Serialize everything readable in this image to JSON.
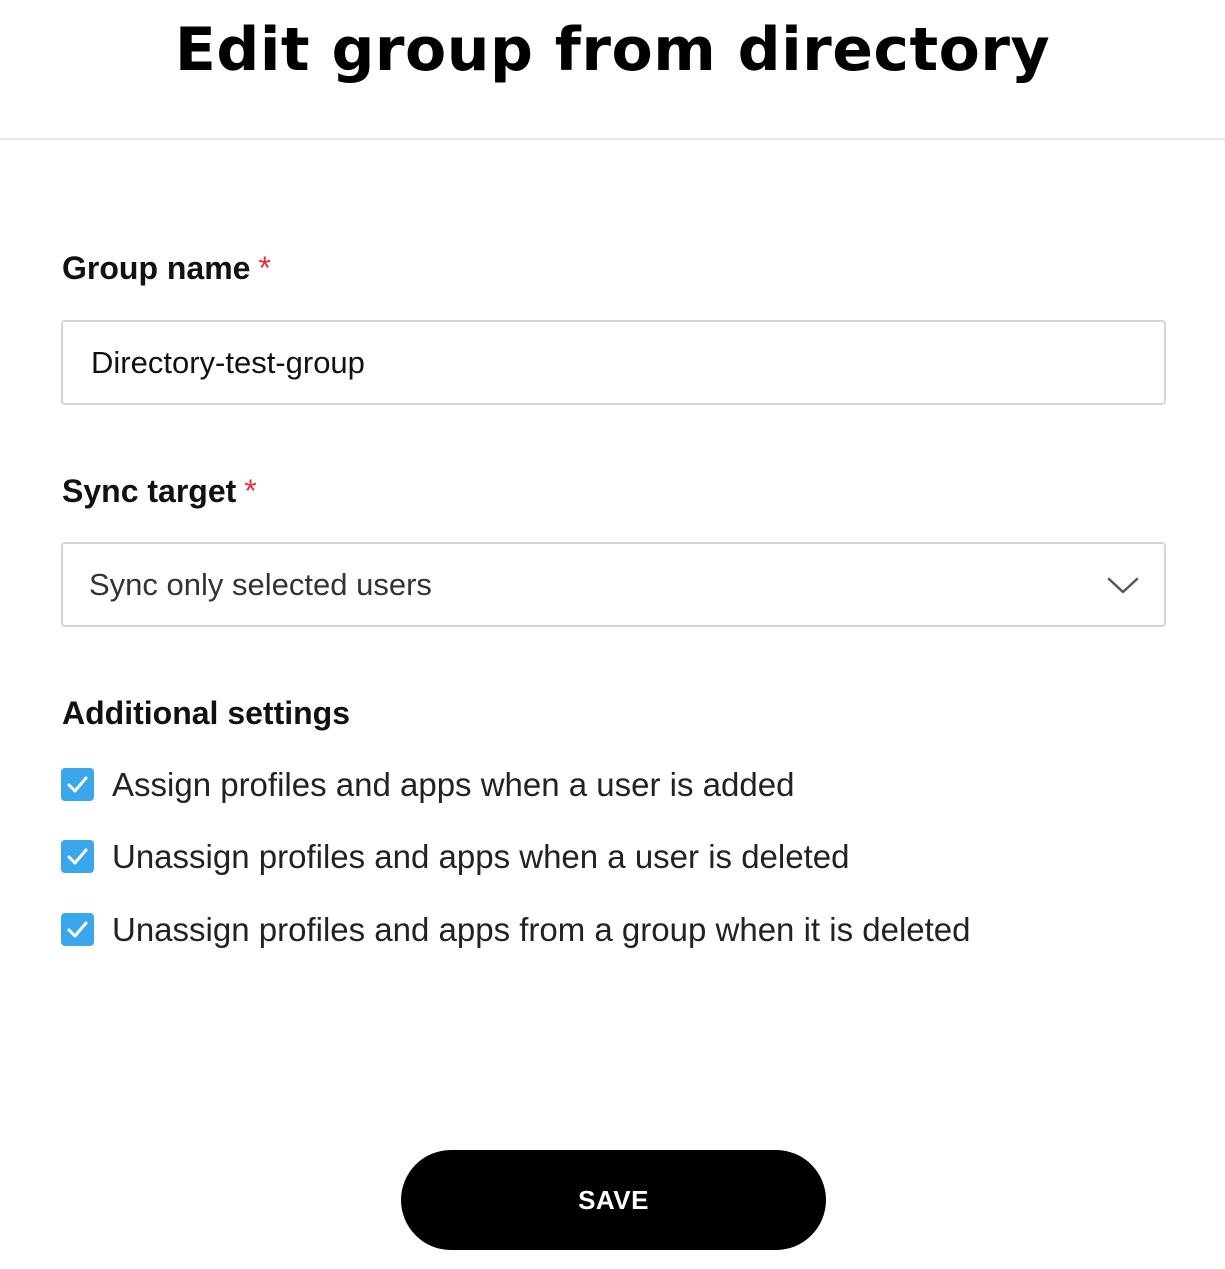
{
  "header": {
    "title": "Edit group from directory"
  },
  "form": {
    "group_name": {
      "label": "Group name",
      "required_mark": "*",
      "value": "Directory-test-group"
    },
    "sync_target": {
      "label": "Sync target",
      "required_mark": "*",
      "selected": "Sync only selected users",
      "icon": "chevron-down-icon"
    },
    "additional_settings": {
      "label": "Additional settings",
      "options": [
        {
          "label": "Assign profiles and apps when a user is added",
          "checked": true
        },
        {
          "label": "Unassign profiles and apps when a user is deleted",
          "checked": true
        },
        {
          "label": "Unassign profiles and apps from a group when it is deleted",
          "checked": true
        }
      ]
    }
  },
  "actions": {
    "save_label": "SAVE"
  },
  "colors": {
    "accent": "#3aa6ec",
    "required": "#e8303a",
    "button_bg": "#000000",
    "border": "#d5d5d5"
  }
}
